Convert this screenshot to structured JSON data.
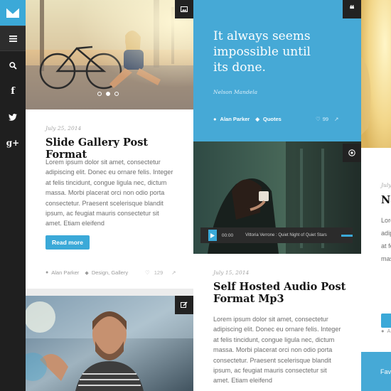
{
  "sidebar": {
    "items": [
      {
        "name": "menu",
        "icon": "hamburger-icon"
      },
      {
        "name": "search",
        "icon": "search-icon"
      },
      {
        "name": "facebook",
        "label": "f"
      },
      {
        "name": "twitter",
        "icon": "twitter-icon"
      },
      {
        "name": "google-plus",
        "label": "g+"
      }
    ]
  },
  "post_gallery": {
    "date": "July 25, 2014",
    "title": "Slide Gallery Post Format",
    "excerpt": "Lorem ipsum dolor sit amet, consectetur adipiscing elit. Donec eu ornare felis. Integer at felis tincidunt, congue ligula nec, dictum massa. Morbi placerat orci non odio porta consectetur. Praesent scelerisque blandit ipsum, ac feugiat mauris consectetur sit amet. Etiam eleifend",
    "read_more": "Read more",
    "author": "Alan Parker",
    "categories": "Design, Gallery",
    "likes": "129",
    "slider_dots": 3,
    "active_dot": 1
  },
  "post_quote": {
    "quote": "It always seems impossible until its done.",
    "author": "Nelson Mandela",
    "by": "Alan Parker",
    "category": "Quotes",
    "likes": "99"
  },
  "post_audio": {
    "date": "July 15, 2014",
    "title": "Self Hosted Audio Post Format Mp3",
    "excerpt": "Lorem ipsum dolor sit amet, consectetur adipiscing elit. Donec eu ornare felis. Integer at felis tincidunt, congue ligula nec, dictum massa. Morbi placerat orci non odio porta consectetur. Praesent scelerisque blandit ipsum, ac feugiat mauris consectetur sit amet. Etiam eleifend",
    "player": {
      "time": "00:00",
      "track": "Vittoria Verrone : Quiet Night of Quiet Stars"
    }
  },
  "post_right_partial": {
    "date": "July",
    "title": "Na",
    "excerpt_fragments": [
      "Lore",
      "adip",
      "at fe",
      "mas"
    ],
    "author_fragment": "A",
    "footer_fragment": "Fav"
  },
  "colors": {
    "accent": "#3ba9d8",
    "sidebar": "#1f1f1f",
    "quote_bg": "#46a9d6"
  }
}
